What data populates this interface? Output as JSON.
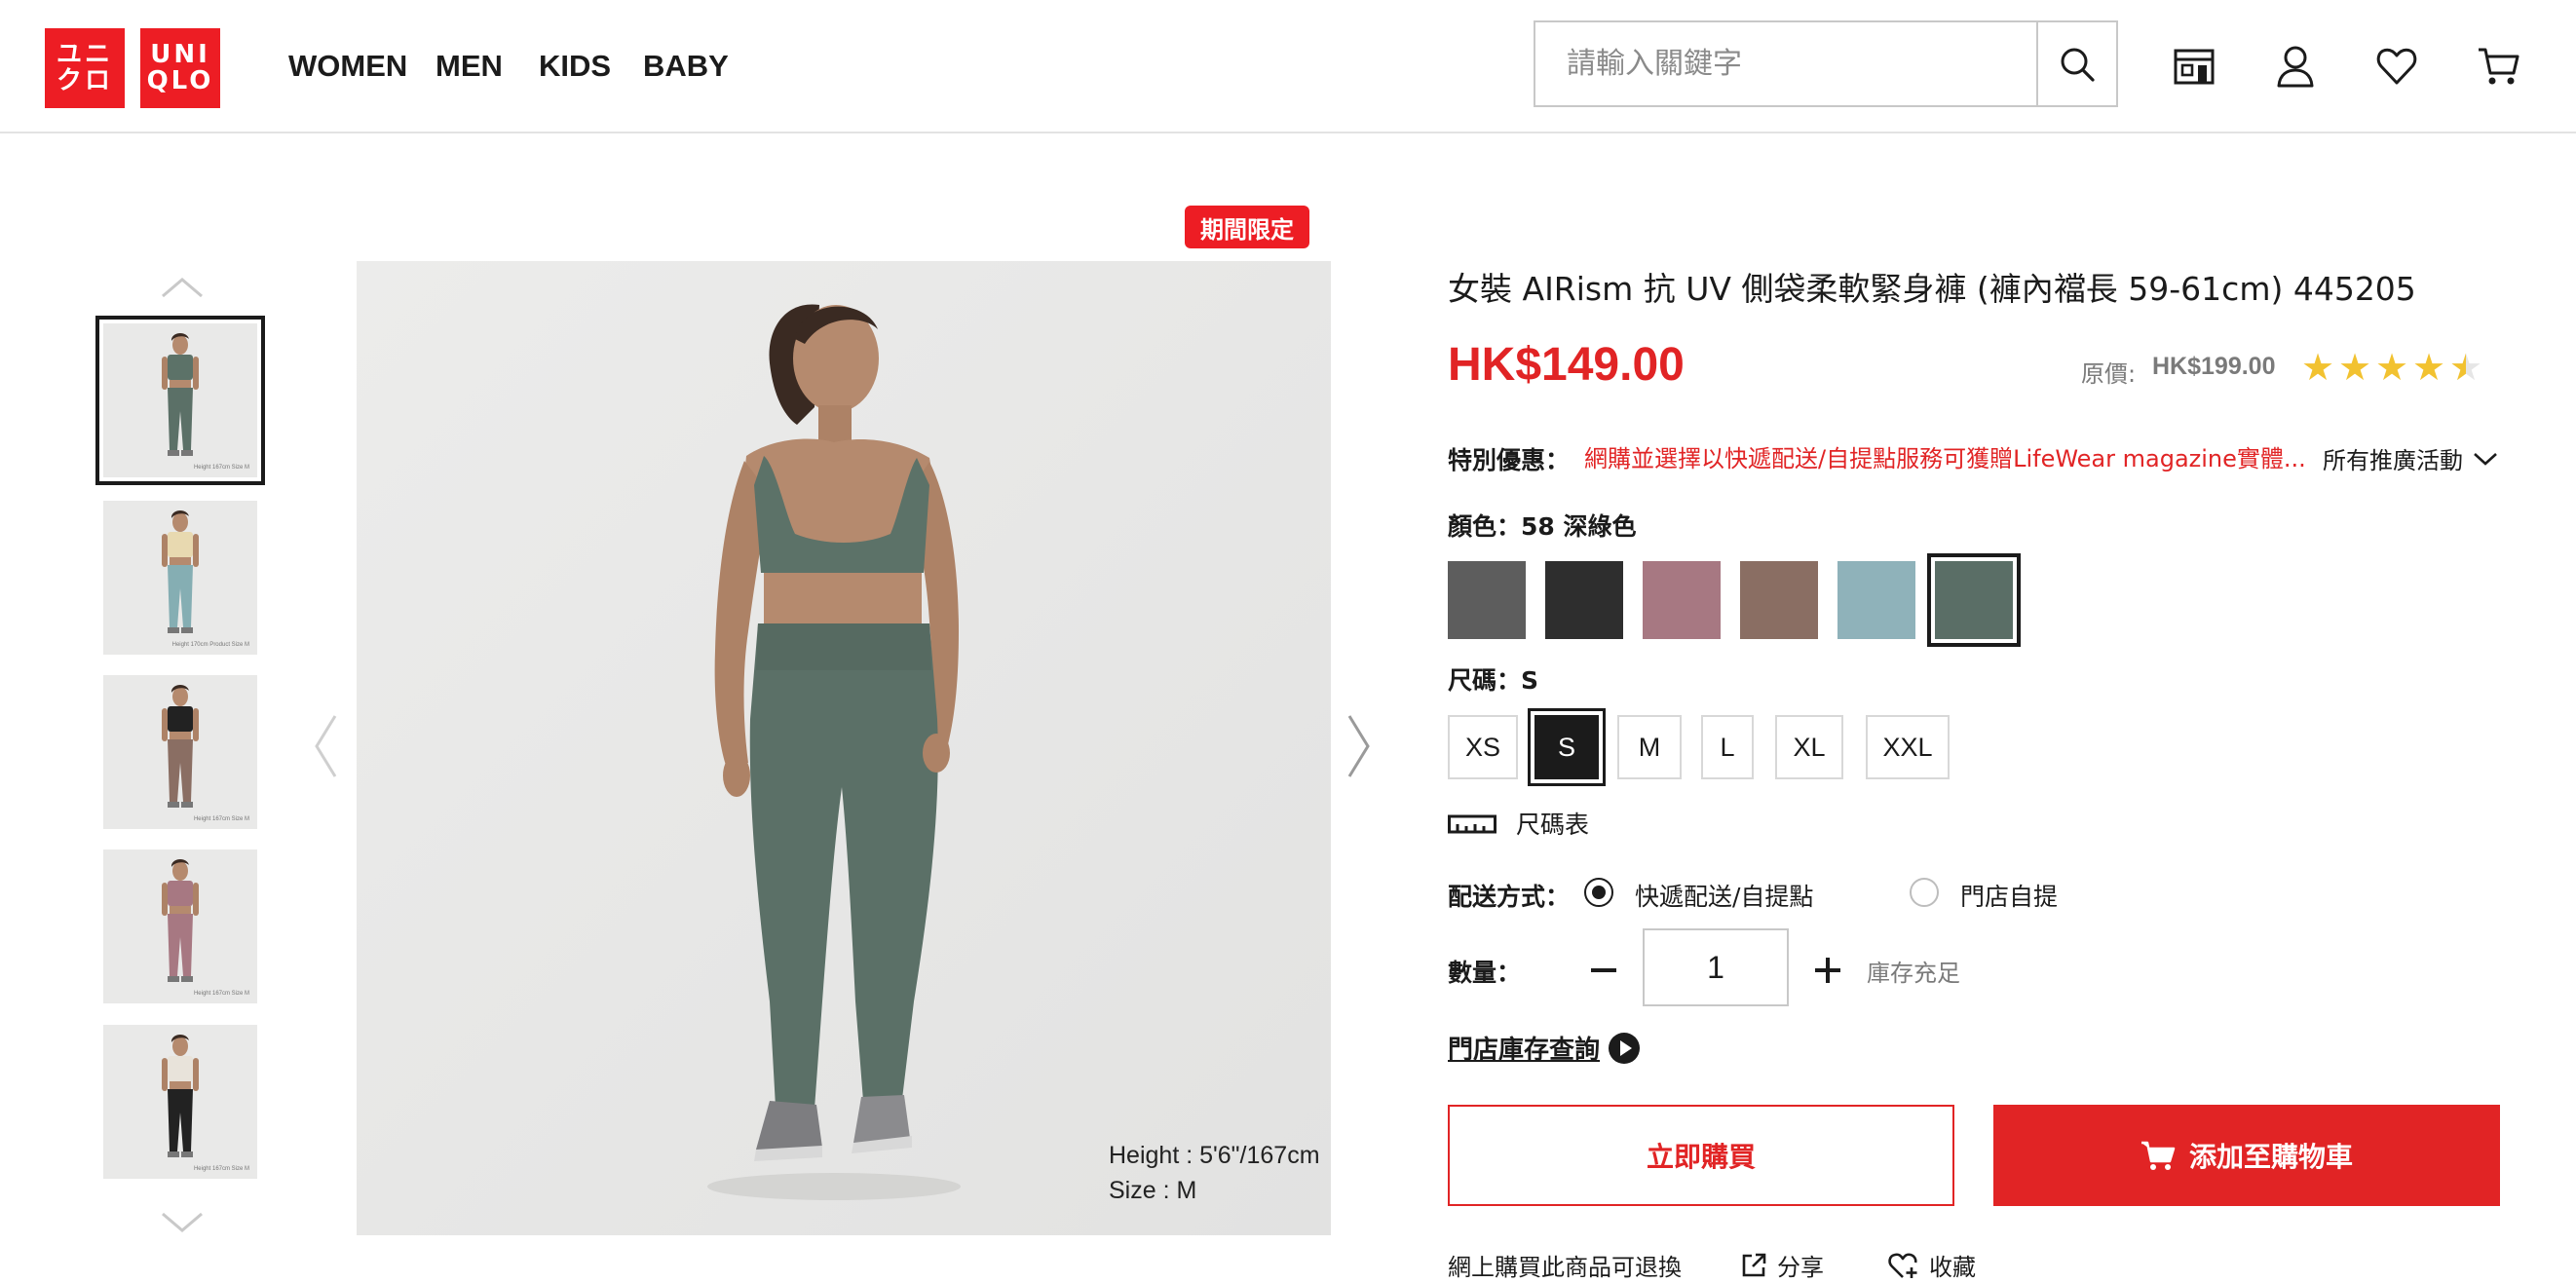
{
  "header": {
    "logo": {
      "top": "ユニクロ",
      "bottom": "UNIQLO",
      "top_line1": "ユニ",
      "top_line2": "クロ",
      "bottom_line1": "UNI",
      "bottom_line2": "QLO"
    },
    "nav": [
      "WOMEN",
      "MEN",
      "KIDS",
      "BABY"
    ],
    "search": {
      "placeholder": "請輸入關鍵字",
      "value": ""
    },
    "icons": [
      "store-icon",
      "account-icon",
      "heart-icon",
      "cart-icon"
    ]
  },
  "gallery": {
    "badge": "期間限定",
    "main_caption": [
      "Height : 5'6\"/167cm",
      "Size : M"
    ],
    "thumbnails": [
      {
        "outfit": "green",
        "caption": "Height 167cm Size M",
        "selected": true
      },
      {
        "outfit": "light-blue",
        "caption": "Height 170cm Product Size M",
        "selected": false
      },
      {
        "outfit": "brown",
        "caption": "Height 167cm Size M",
        "selected": false
      },
      {
        "outfit": "pink",
        "caption": "Height 167cm Size M",
        "selected": false
      },
      {
        "outfit": "black",
        "caption": "Height 167cm Size M",
        "selected": false
      }
    ]
  },
  "product": {
    "title": "女裝 AIRism 抗 UV 側袋柔軟緊身褲 (褲內襠長 59-61cm) 445205",
    "sale_price": "HK$149.00",
    "original_price_label": "原價:",
    "original_price": "HK$199.00",
    "rating": 4.5,
    "offer_label": "特別優惠：",
    "offer_text": "網購並選擇以快遞配送/自提點服務可獲贈LifeWear magazine實體...",
    "all_promotions": "所有推廣活動",
    "color_label": "顏色：58 深綠色",
    "colors": [
      {
        "name": "gray",
        "hex": "#5d5d5d"
      },
      {
        "name": "black",
        "hex": "#2e2e2e"
      },
      {
        "name": "pink",
        "hex": "#a77882"
      },
      {
        "name": "brown",
        "hex": "#8a6e63"
      },
      {
        "name": "light-blue",
        "hex": "#8fb2ba"
      },
      {
        "name": "dark-green",
        "hex": "#5a6e66"
      }
    ],
    "selected_color": 5,
    "size_label": "尺碼：S",
    "sizes": [
      "XS",
      "S",
      "M",
      "L",
      "XL",
      "XXL"
    ],
    "selected_size": 1,
    "size_chart": "尺碼表",
    "shipping_label": "配送方式：",
    "shipping_options": [
      "快遞配送/自提點",
      "門店自提"
    ],
    "selected_shipping": 0,
    "quantity_label": "數量：",
    "quantity": "1",
    "stock_status": "庫存充足",
    "store_stock_link": "門店庫存查詢",
    "buy_now": "立即購買",
    "add_to_cart": "添加至購物車",
    "return_note": "網上購買此商品可退換",
    "share": "分享",
    "favorite": "收藏"
  },
  "colors": {
    "accent": "#e12425",
    "brand": "#ed1d24",
    "text": "#1b1b1b",
    "muted": "#7a7a7a",
    "star": "#f2c230"
  }
}
